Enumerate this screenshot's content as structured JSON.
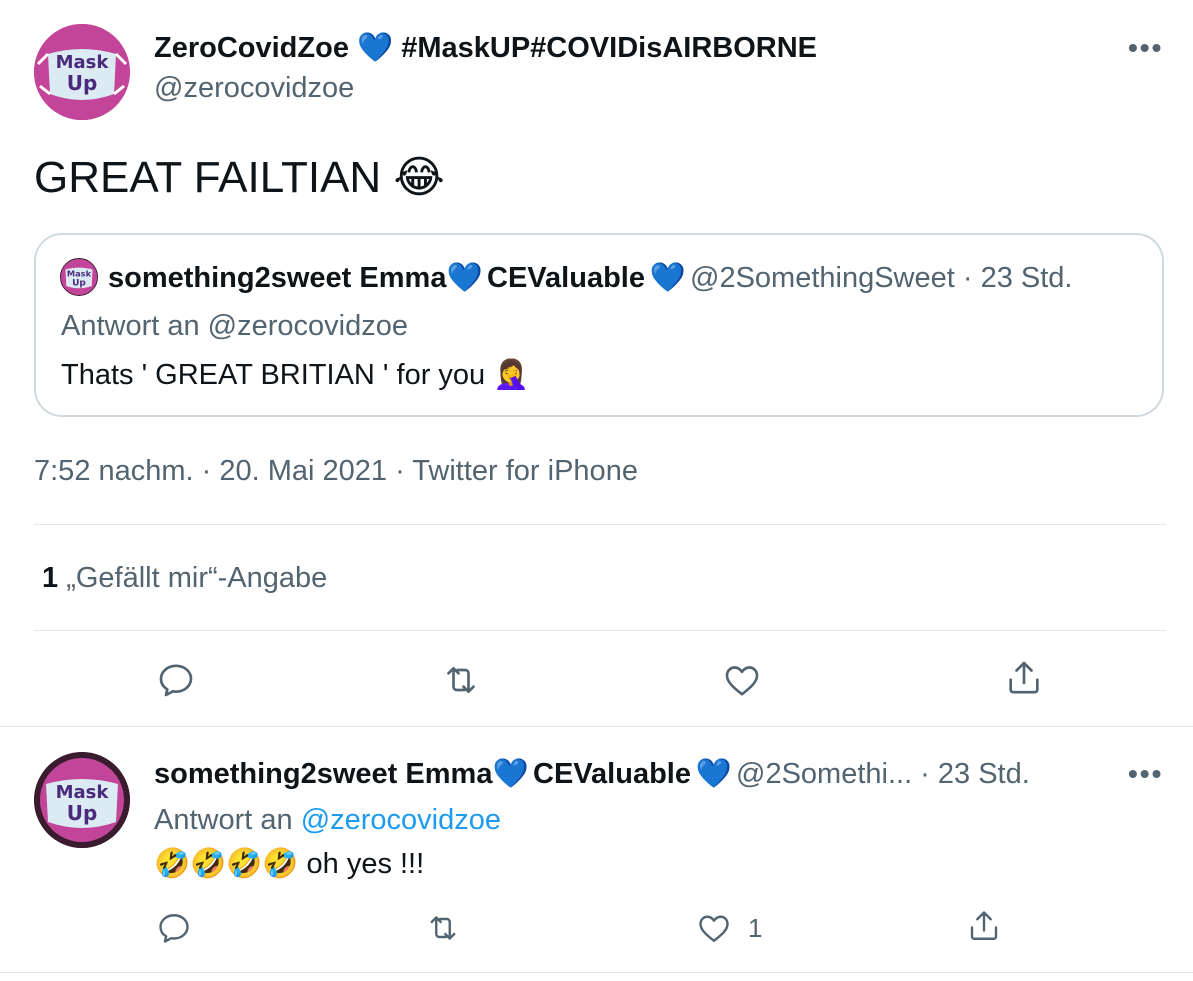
{
  "main_tweet": {
    "author_name": "ZeroCovidZoe",
    "author_heart": "💙",
    "author_tags": "#MaskUP#COVIDisAIRBORNE",
    "handle": "@zerocovidzoe",
    "avatar_text_line1": "Mask",
    "avatar_text_line2": "Up",
    "more_icon": "•••",
    "text": "GREAT FAILTIAN",
    "text_emoji": "😂",
    "quoted": {
      "author_name": "something2sweet Emma",
      "heart1": "💙",
      "author_name2": "CEValuable",
      "heart2": "💙",
      "handle_time": "@2SomethingSweet · 23 Std.",
      "reply_to": "Antwort an @zerocovidzoe",
      "text": "Thats ' GREAT BRITIAN ' for you",
      "text_emoji": "🤦‍♀️",
      "avatar_text_line1": "Mask",
      "avatar_text_line2": "Up"
    },
    "timestamp": "7:52 nachm. · 20. Mai 2021 · Twitter for iPhone",
    "likes_count": "1",
    "likes_label": "„Gefällt mir“-Angabe"
  },
  "reply_tweet": {
    "author_name": "something2sweet Emma",
    "heart1": "💙",
    "author_name2": "CEValuable",
    "heart2": "💙",
    "handle_time": "@2Somethi... · 23 Std.",
    "more_icon": "•••",
    "reply_prefix": "Antwort an",
    "reply_handle": "@zerocovidzoe",
    "text_emojis": "🤣🤣🤣🤣",
    "text": "oh yes !!!",
    "like_count": "1",
    "avatar_text_line1": "Mask",
    "avatar_text_line2": "Up"
  },
  "colors": {
    "accent_link": "#1d9bf0",
    "secondary_text": "#536471",
    "heart_blue": "#5b9fe0",
    "avatar_pink": "#c2459a"
  },
  "icons": [
    "reply-icon",
    "retweet-icon",
    "like-icon",
    "share-icon",
    "more-icon"
  ]
}
